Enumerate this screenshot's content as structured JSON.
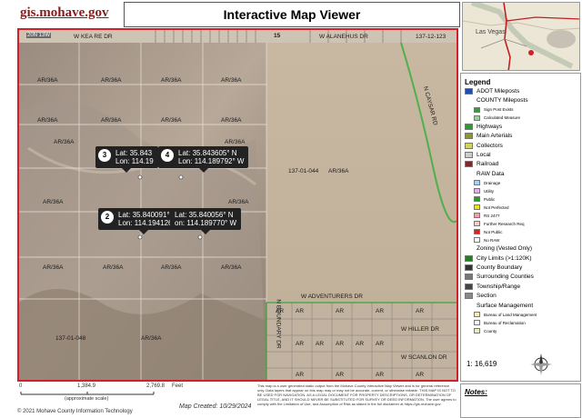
{
  "header": {
    "site": "gis.mohave.gov",
    "title": "Interactive Map Viewer"
  },
  "inset": {
    "city_label": "Las Vegas"
  },
  "map": {
    "township_label": "20N 13W",
    "roads": [
      {
        "name": "W KEA RE DR"
      },
      {
        "name": "W ALANEHUS DR"
      },
      {
        "name": "N CAYSAR RD"
      },
      {
        "name": "W ADVENTURERS DR"
      },
      {
        "name": "N BOUNDARY DR"
      },
      {
        "name": "W HILLER DR"
      },
      {
        "name": "W SCANLON DR"
      }
    ],
    "parcel_code": "AR/36A",
    "ar_code": "AR",
    "parcel_ids": [
      "137-12-123",
      "137-01-044",
      "137-01-048"
    ],
    "route_label": "15",
    "popups": [
      {
        "num": "3",
        "lat": "Lat: 35.843",
        "lon": "Lon: 114.19"
      },
      {
        "num": "4",
        "lat": "Lat: 35.843605° N",
        "lon": "Lon: 114.189792° W"
      },
      {
        "num": "2",
        "lat": "Lat: 35.840091° N",
        "lon": "Lon: 114.194126° W"
      },
      {
        "num": "",
        "lat": "Lat: 35.840056° N",
        "lon": "on: 114.189770° W"
      }
    ]
  },
  "legend": {
    "title": "Legend",
    "items": [
      {
        "label": "ADOT Mileposts",
        "color": "#1f4fa8"
      },
      {
        "label": "COUNTY Mileposts",
        "color": ""
      },
      {
        "label": "Sign Post Exists",
        "color": "#3a9a3a"
      },
      {
        "label": "Calculated Measure",
        "color": "#9ecf9e"
      },
      {
        "label": "Highways",
        "color": "#2f9a2f"
      },
      {
        "label": "Main Arterials",
        "color": "#8a9a2a"
      },
      {
        "label": "Collectors",
        "color": "#cfd26a"
      },
      {
        "label": "Local",
        "color": "#cccccc"
      },
      {
        "label": "Railroad",
        "color": "#7a2a2a"
      },
      {
        "label": "RAW Data",
        "color": ""
      },
      {
        "label": "Drainage",
        "color": "#9fd4f4"
      },
      {
        "label": "Utility",
        "color": "#e0b0f0"
      },
      {
        "label": "Public",
        "color": "#2a9a2a"
      },
      {
        "label": "Not Perfected",
        "color": "#f0e020"
      },
      {
        "label": "RS 2477",
        "color": "#f2a0b0"
      },
      {
        "label": "Further Research Req",
        "color": "#f6d0c8"
      },
      {
        "label": "Not Public",
        "color": "#e02020"
      },
      {
        "label": "No RAW",
        "color": "#ffffff"
      },
      {
        "label": "Zoning (Vested Only)",
        "color": ""
      },
      {
        "label": "City Limits (>1:120K)",
        "color": "#2a7a2a"
      },
      {
        "label": "County Boundary",
        "color": "#333333"
      },
      {
        "label": "Surrounding Counties",
        "color": "#777777"
      },
      {
        "label": "Township/Range",
        "color": "#444444"
      },
      {
        "label": "Section",
        "color": "#888888"
      },
      {
        "label": "Surface Management",
        "color": ""
      },
      {
        "label": "Bureau of Land Management",
        "color": "#f8ecb0"
      },
      {
        "label": "Bureau of Reclamation",
        "color": "#ffffff"
      },
      {
        "label": "County",
        "color": "#e0f0c0"
      }
    ],
    "scale_ratio": "1: 16,619"
  },
  "footer": {
    "scale_ticks": [
      "0",
      "1,384.9",
      "2,769.8"
    ],
    "scale_unit": "Feet",
    "approx_scale": "(approximate scale)",
    "copyright": "© 2021 Mohave County Information Technology",
    "created": "Map Created: 10/29/2024",
    "disclaimer": "This map is a user generated static output from the Mohave County Interactive Map Viewer and is for general reference only. Data layers that appear on this map may or may not be accurate, current, or otherwise reliable. THIS MAP IS NOT TO BE USED FOR NAVIGATION. AS A LEGAL DOCUMENT FOR PROPERTY DESCRIPTIONS, OR DETERMINATION OF LEGAL TITLE, AND IT SHOULD NEVER BE SUBSTITUTED FOR SURVEY OR DEED INFORMATION. The user agrees to comply with the Limitation of Use, and Assumption of Risk as stated in the full disclaimer at https://gis.mohave.gov"
  },
  "notes": {
    "label": "Notes:"
  }
}
